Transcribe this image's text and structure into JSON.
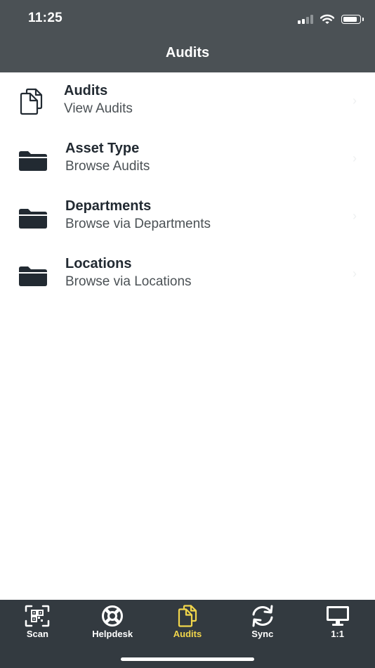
{
  "status_bar": {
    "time": "11:25"
  },
  "header": {
    "title": "Audits"
  },
  "list": {
    "items": [
      {
        "title": "Audits",
        "subtitle": "View Audits",
        "icon": "documents-icon"
      },
      {
        "title": "Asset Type",
        "subtitle": "Browse Audits",
        "icon": "folder-icon"
      },
      {
        "title": "Departments",
        "subtitle": "Browse via Departments",
        "icon": "folder-icon"
      },
      {
        "title": "Locations",
        "subtitle": "Browse via Locations",
        "icon": "folder-icon"
      }
    ],
    "chevron": "›"
  },
  "tab_bar": {
    "tabs": [
      {
        "label": "Scan",
        "icon": "qr-scan-icon",
        "active": false
      },
      {
        "label": "Helpdesk",
        "icon": "lifebuoy-icon",
        "active": false
      },
      {
        "label": "Audits",
        "icon": "documents-icon",
        "active": true
      },
      {
        "label": "Sync",
        "icon": "sync-icon",
        "active": false
      },
      {
        "label": "1:1",
        "icon": "monitor-icon",
        "active": false
      }
    ]
  },
  "colors": {
    "header_bg": "#4b5155",
    "tab_bar_bg": "#333a40",
    "active_tab": "#f2d64b",
    "text_dark": "#222a32"
  }
}
